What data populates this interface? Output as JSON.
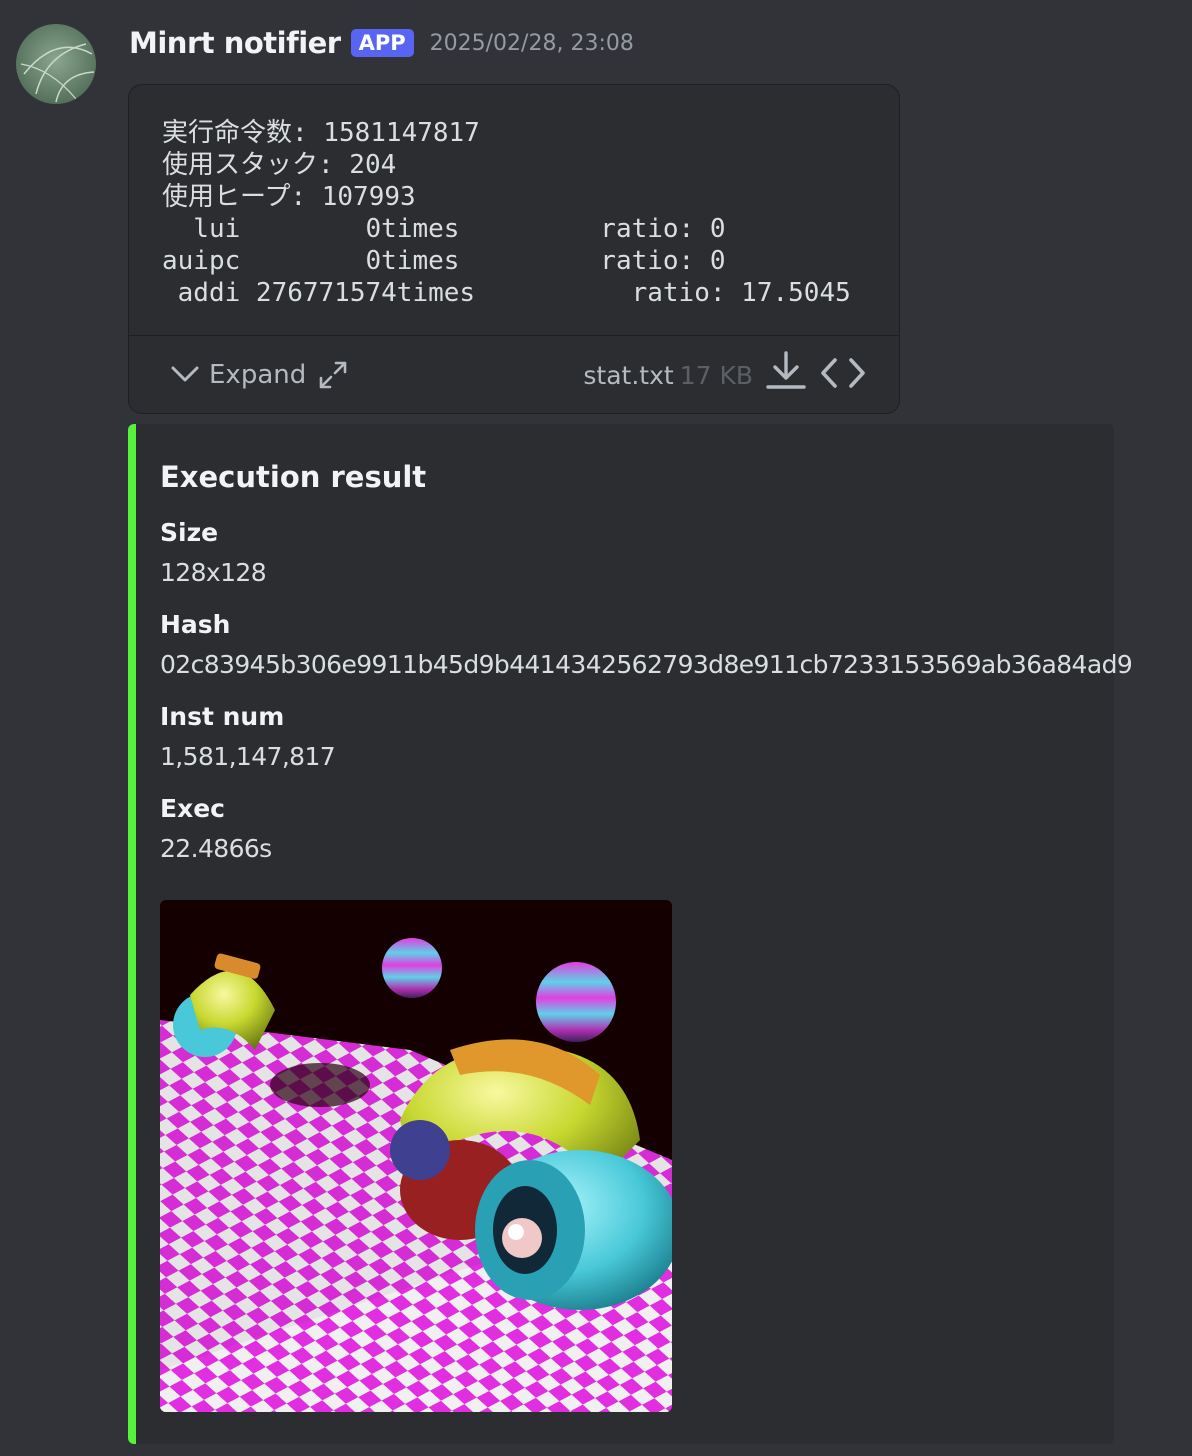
{
  "message": {
    "author": "Minrt notifier",
    "badge": "APP",
    "timestamp": "2025/02/28, 23:08"
  },
  "attachment": {
    "content": "実行命令数: 1581147817\n使用スタック: 204\n使用ヒープ: 107993\n  lui        0times         ratio: 0\nauipc        0times         ratio: 0\n addi 276771574times          ratio: 17.5045",
    "expand_label": "Expand",
    "file_name": "stat.txt",
    "file_size": "17 KB"
  },
  "embed": {
    "accent_color": "#57f23b",
    "title": "Execution result",
    "fields": [
      {
        "name": "Size",
        "value": "128x128"
      },
      {
        "name": "Hash",
        "value": "02c83945b306e9911b45d9b4414342562793d8e911cb7233153569ab36a84ad9"
      },
      {
        "name": "Inst num",
        "value": "1,581,147,817"
      },
      {
        "name": "Exec",
        "value": "22.4866s"
      }
    ]
  },
  "icons": {
    "expand": "chevron-down-icon",
    "fullscreen": "fullscreen-icon",
    "download": "download-icon",
    "code": "code-icon"
  }
}
